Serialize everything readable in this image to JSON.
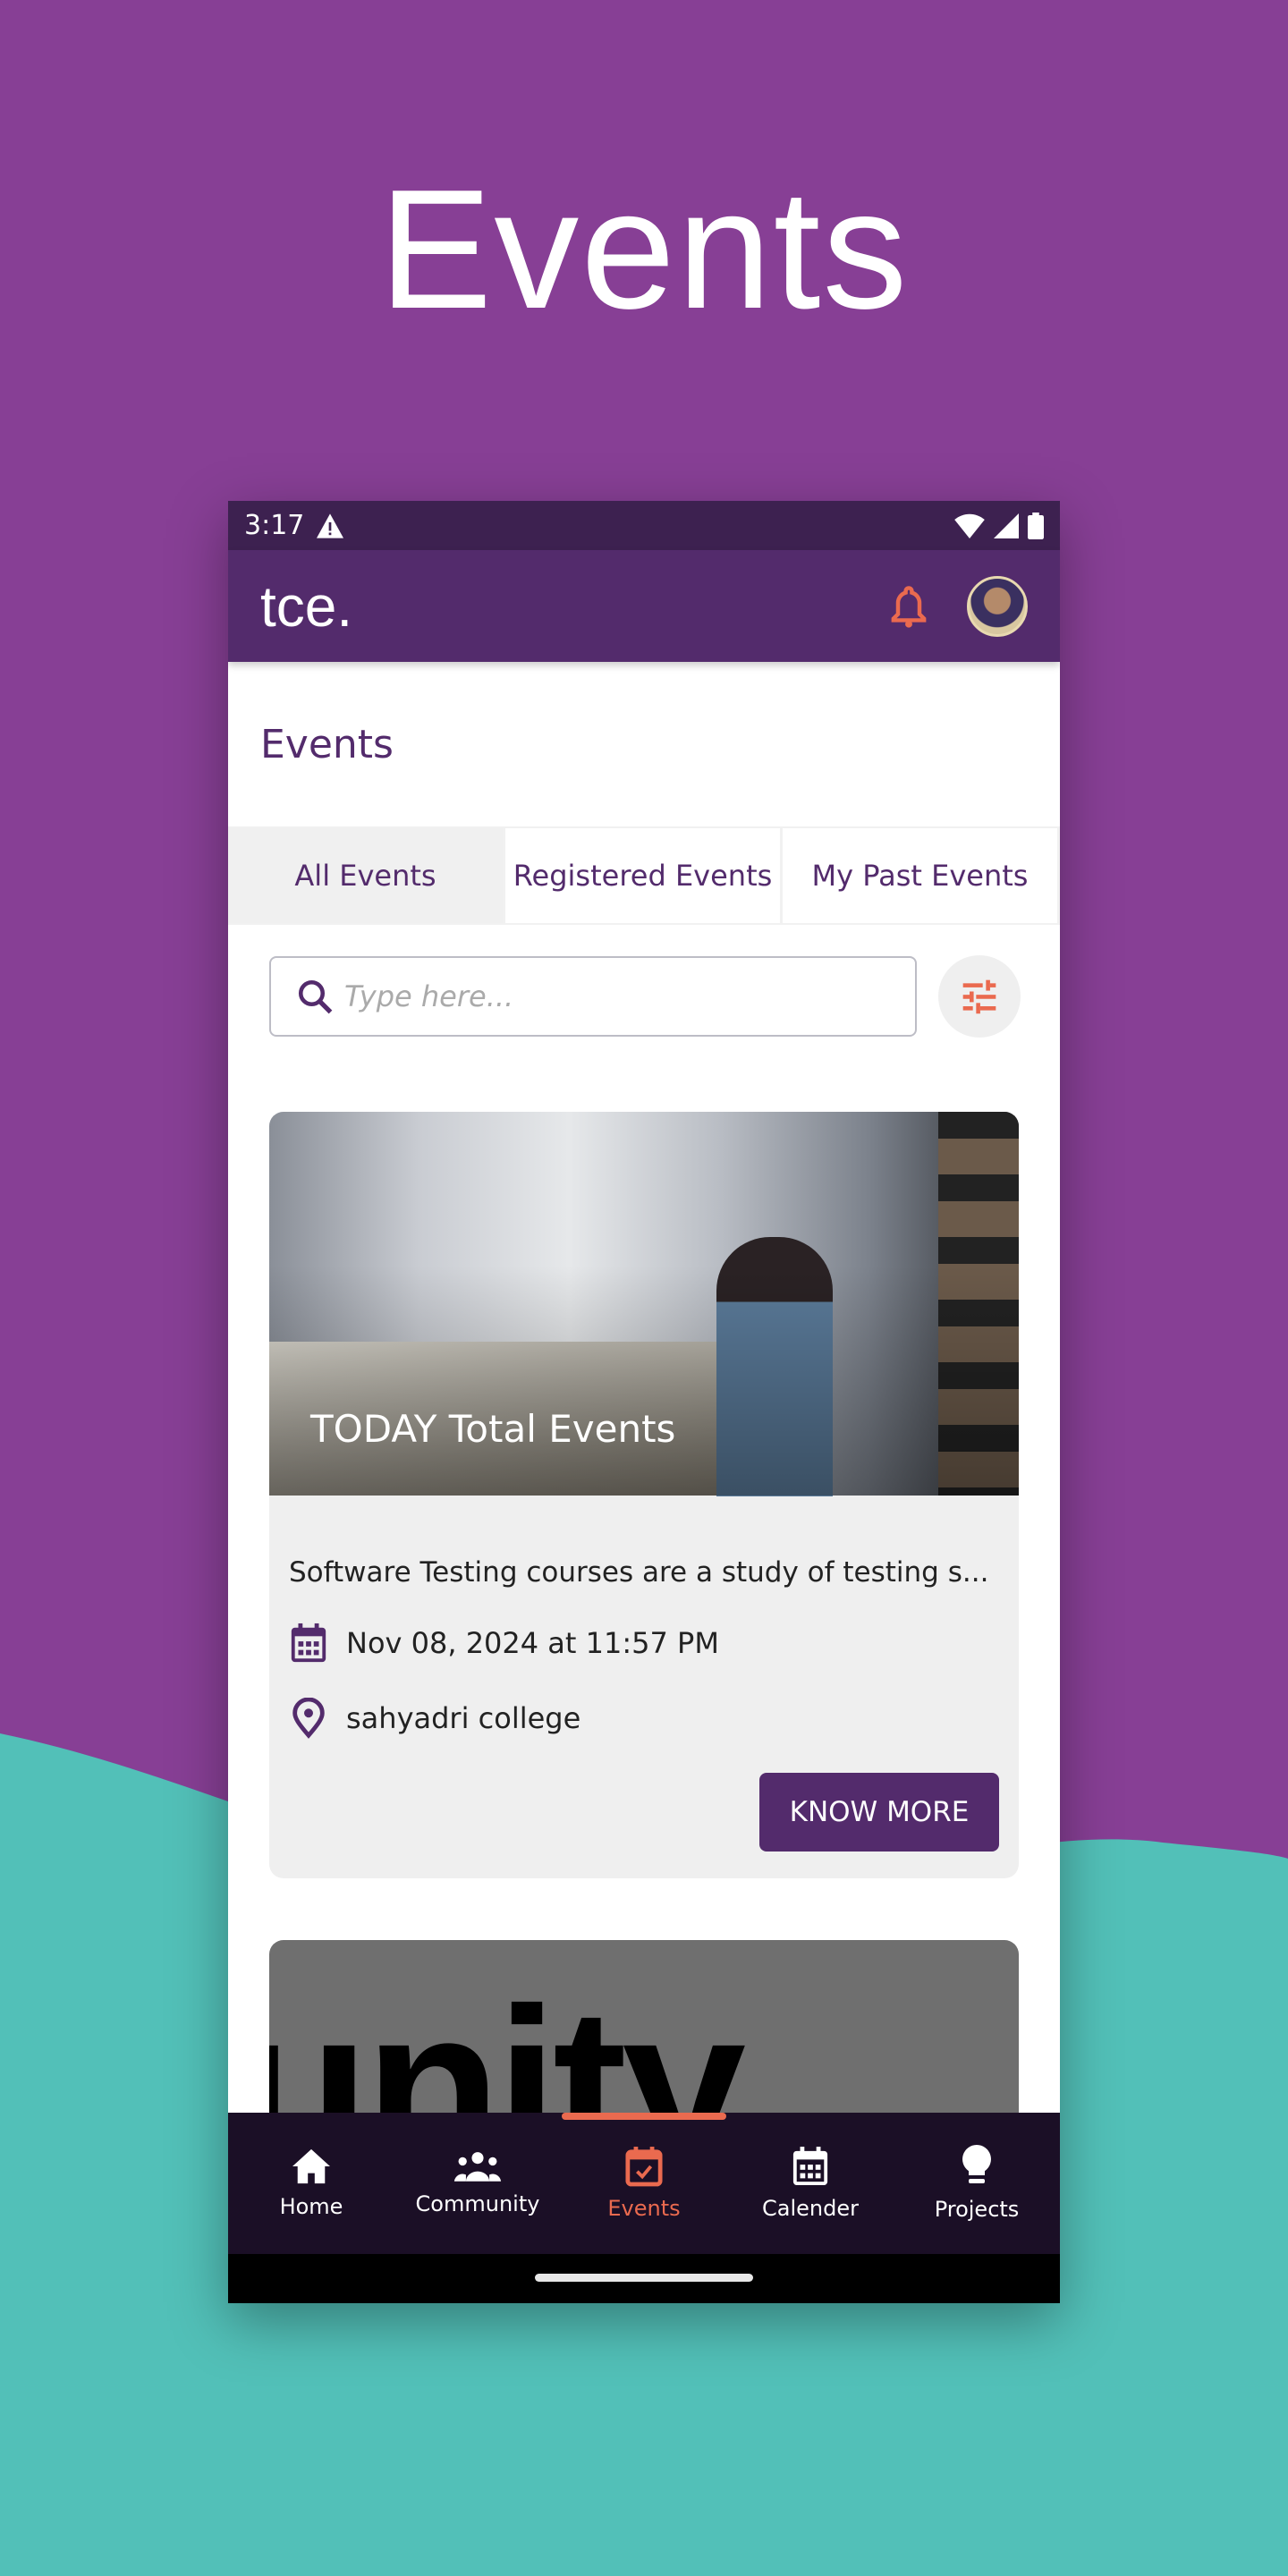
{
  "hero_title": "Events",
  "colors": {
    "background": "#873f95",
    "wave": "#52c0b8",
    "primary": "#532b6c",
    "accent": "#ea6a4f",
    "nav": "#1b0f26"
  },
  "status": {
    "time": "3:17",
    "icons": [
      "warning-icon",
      "wifi-icon",
      "signal-icon",
      "battery-icon"
    ]
  },
  "appbar": {
    "logo": "tce.",
    "icons": [
      "bell-icon",
      "avatar"
    ]
  },
  "page": {
    "title": "Events"
  },
  "tabs": [
    {
      "label": "All Events",
      "active": true
    },
    {
      "label": "Registered Events",
      "active": false
    },
    {
      "label": "My Past Events",
      "active": false
    }
  ],
  "search": {
    "placeholder": "Type here...",
    "value": ""
  },
  "events": [
    {
      "image_caption": "TODAY Total Events",
      "description": "Software Testing courses are a study of testing s...",
      "date": "Nov 08, 2024 at 11:57 PM",
      "location": "sahyadri college",
      "button": "KNOW MORE"
    },
    {
      "image_text": "unity"
    }
  ],
  "nav": [
    {
      "label": "Home",
      "icon": "home-icon"
    },
    {
      "label": "Community",
      "icon": "community-icon"
    },
    {
      "label": "Events",
      "icon": "event-check-icon",
      "active": true
    },
    {
      "label": "Calender",
      "icon": "calendar-icon"
    },
    {
      "label": "Projects",
      "icon": "lightbulb-icon"
    }
  ]
}
